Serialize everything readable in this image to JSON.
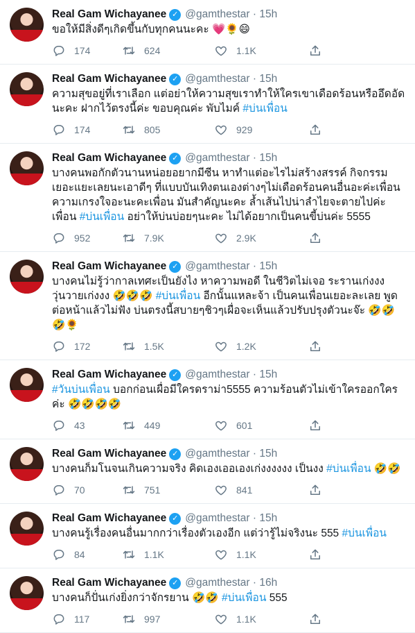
{
  "tweets": [
    {
      "name": "Real Gam Wichayanee",
      "handle": "@gamthestar",
      "time": "15h",
      "segments": [
        {
          "t": "ขอให้มีสิ่งดีๆเกิดขึ้นกับทุกคนนะคะ 💗🌻😄"
        }
      ],
      "replies": "174",
      "retweets": "624",
      "likes": "1.1K"
    },
    {
      "name": "Real Gam Wichayanee",
      "handle": "@gamthestar",
      "time": "15h",
      "segments": [
        {
          "t": "ความสุขอยู่ที่เราเลือก แต่อย่าให้ความสุขเราทำให้ใครเขาเดือดร้อนหรืออึดอัดนะคะ ฝากไว้ตรงนี้ค่ะ ขอบคุณค่ะ พับไมค์ "
        },
        {
          "t": "#บ่นเพื่อน",
          "tag": true
        }
      ],
      "replies": "174",
      "retweets": "805",
      "likes": "929"
    },
    {
      "name": "Real Gam Wichayanee",
      "handle": "@gamthestar",
      "time": "15h",
      "segments": [
        {
          "t": "บางคนพอกักตัวนานหน่อยอยากมีซีน หาทำแต่อะไรไม่สร้างสรรค์ กิจกรรมเยอะแยะเลยนะเอาดีๆ ที่แบบบันเทิงตนเองต่างๆไม่เดือดร้อนคนอื่นอะค่ะเพื่อน ความเกรงใจอะนะคะเพื่อน มันสำคัญนะคะ ล้ำเส้นไปน่าลำไยจะตายไปค่ะเพื่อน "
        },
        {
          "t": "#บ่นเพื่อน",
          "tag": true
        },
        {
          "t": " อย่าให้บ่นบ่อยๆนะคะ ไม่ได้อยากเป็นคนขี้บ่นค่ะ 5555"
        }
      ],
      "replies": "952",
      "retweets": "7.9K",
      "likes": "2.9K"
    },
    {
      "name": "Real Gam Wichayanee",
      "handle": "@gamthestar",
      "time": "15h",
      "segments": [
        {
          "t": "บางคนไม่รู้ว่ากาลเทศะเป็นยังไง หาความพอดี ในชีวิตไม่เจอ ระรานเก่งงง วุ่นวายเก่งงง 🤣🤣🤣 "
        },
        {
          "t": "#บ่นเพื่อน",
          "tag": true
        },
        {
          "t": " อีกนั้นแหละจ้า เป็นคนเพื่อนเยอะละเลย พูดต่อหน้าแล้วไม่ฟัง บ่นตรงนี้สบายๆชิวๆเผื่อจะเห็นแล้วปรับปรุงตัวนะจ๊ะ 🤣🤣🤣🌻"
        }
      ],
      "replies": "172",
      "retweets": "1.5K",
      "likes": "1.2K"
    },
    {
      "name": "Real Gam Wichayanee",
      "handle": "@gamthestar",
      "time": "15h",
      "segments": [
        {
          "t": "#วันบ่นเพื่อน",
          "tag": true
        },
        {
          "t": " บอกก่อนเผื่อมีใครดราม่า5555 ความร้อนตัวไม่เข้าใครออกใครค่ะ 🤣🤣🤣🤣"
        }
      ],
      "replies": "43",
      "retweets": "449",
      "likes": "601"
    },
    {
      "name": "Real Gam Wichayanee",
      "handle": "@gamthestar",
      "time": "15h",
      "segments": [
        {
          "t": "บางคนก็มโนจนเกินความจริง คิดเองเออเองเก่งงงงงง เป็นงง "
        },
        {
          "t": "#บ่นเพื่อน",
          "tag": true
        },
        {
          "t": " 🤣🤣"
        }
      ],
      "replies": "70",
      "retweets": "751",
      "likes": "841"
    },
    {
      "name": "Real Gam Wichayanee",
      "handle": "@gamthestar",
      "time": "15h",
      "segments": [
        {
          "t": "บางคนรู้เรื่องคนอื่นมากกว่าเรื่องตัวเองอีก แต่ว่ารู้ไม่จริงนะ 555 "
        },
        {
          "t": "#บ่นเพื่อน",
          "tag": true
        }
      ],
      "replies": "84",
      "retweets": "1.1K",
      "likes": "1.1K"
    },
    {
      "name": "Real Gam Wichayanee",
      "handle": "@gamthestar",
      "time": "16h",
      "segments": [
        {
          "t": "บางคนก็ปั่นเก่งยิ่งกว่าจักรยาน 🤣🤣 "
        },
        {
          "t": "#บ่นเพื่อน",
          "tag": true
        },
        {
          "t": " 555"
        }
      ],
      "replies": "117",
      "retweets": "997",
      "likes": "1.1K"
    }
  ]
}
